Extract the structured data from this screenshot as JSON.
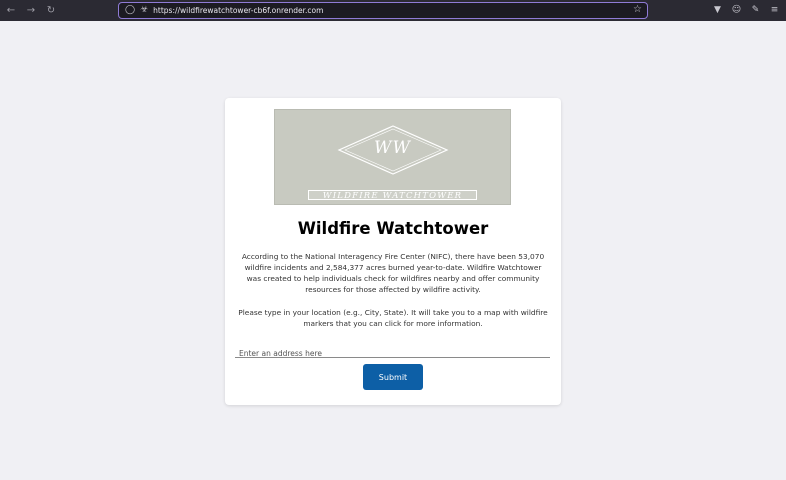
{
  "browser": {
    "url": "https://wildfirewatchtower-cb6f.onrender.com",
    "icons": [
      "back-icon",
      "forward-icon",
      "reload-icon",
      "shield-icon",
      "lock-icon",
      "star-icon",
      "pocket-icon",
      "account-icon",
      "extensions-icon",
      "menu-icon"
    ]
  },
  "logo": {
    "monogram": "WW",
    "subtitle": "WILDFIRE WATCHTOWER"
  },
  "page": {
    "title": "Wildfire Watchtower",
    "intro": "According to the National Interagency Fire Center (NIFC), there have been 53,070 wildfire incidents and 2,584,377 acres burned year-to-date. Wildfire Watchtower was created to help individuals check for wildfires nearby and offer community resources for those affected by wildfire activity.",
    "instructions": "Please type in your location (e.g., City, State). It will take you to a map with wildfire markers that you can click for more information."
  },
  "form": {
    "placeholder": "Enter an address here",
    "value": "",
    "submit_label": "Submit"
  },
  "colors": {
    "button": "#0d5fa6",
    "logo_bg": "#c8cac1",
    "url_focus": "#8f7bd6"
  }
}
